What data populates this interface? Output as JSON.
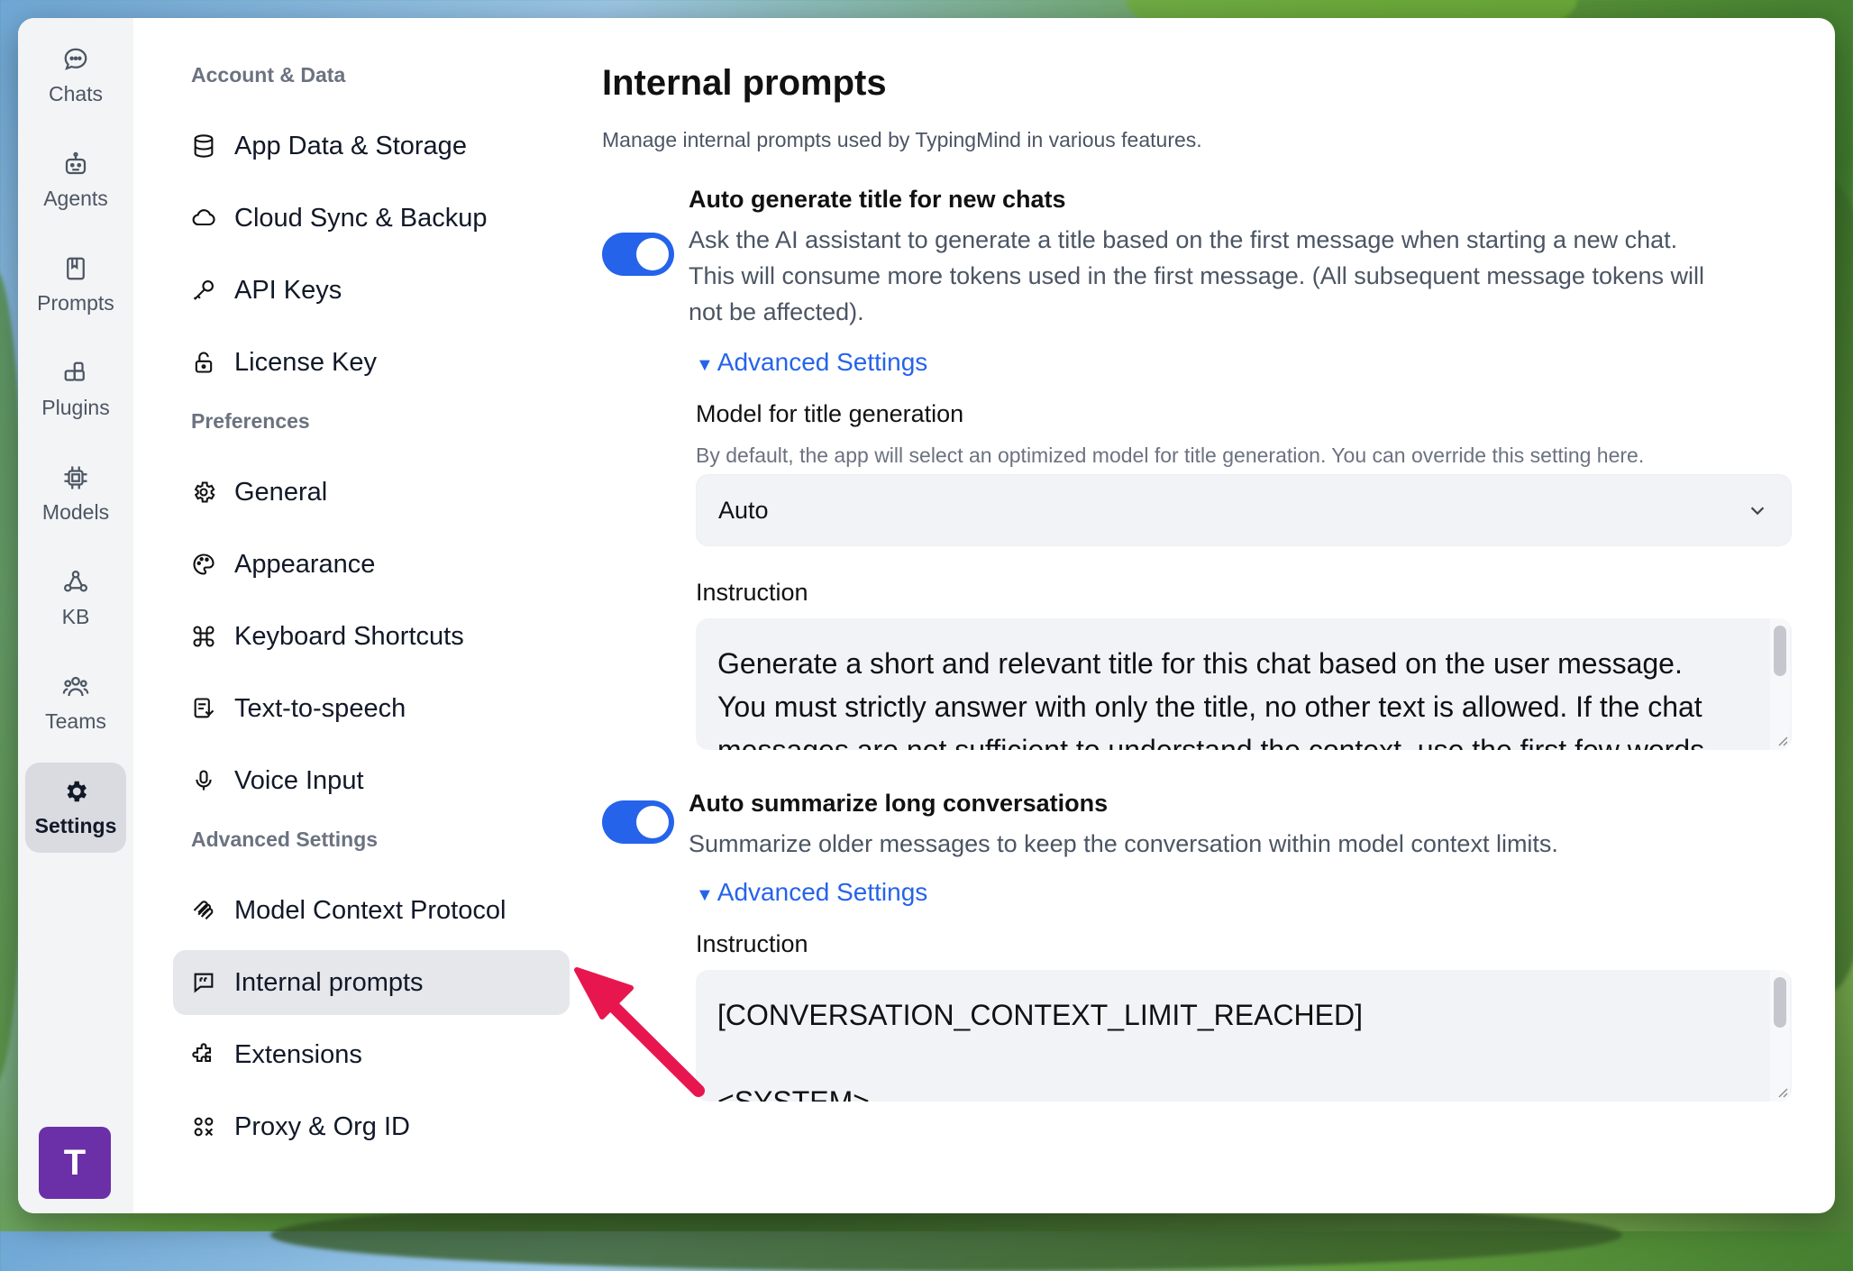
{
  "rail": {
    "items": [
      {
        "label": "Chats",
        "icon": "chat-bubble-icon"
      },
      {
        "label": "Agents",
        "icon": "agents-icon"
      },
      {
        "label": "Prompts",
        "icon": "book-icon"
      },
      {
        "label": "Plugins",
        "icon": "plugin-icon"
      },
      {
        "label": "Models",
        "icon": "chip-icon"
      },
      {
        "label": "KB",
        "icon": "knowledge-base-icon"
      },
      {
        "label": "Teams",
        "icon": "people-icon"
      },
      {
        "label": "Settings",
        "icon": "gear-icon",
        "active": true
      }
    ],
    "avatar_initial": "T",
    "avatar_color": "#6b2fa8"
  },
  "nav": {
    "sections": [
      {
        "title": "Account & Data",
        "items": [
          {
            "label": "App Data & Storage",
            "icon": "database-icon"
          },
          {
            "label": "Cloud Sync & Backup",
            "icon": "cloud-icon"
          },
          {
            "label": "API Keys",
            "icon": "key-icon"
          },
          {
            "label": "License Key",
            "icon": "lock-icon"
          }
        ]
      },
      {
        "title": "Preferences",
        "items": [
          {
            "label": "General",
            "icon": "gear-icon"
          },
          {
            "label": "Appearance",
            "icon": "palette-icon"
          },
          {
            "label": "Keyboard Shortcuts",
            "icon": "command-icon"
          },
          {
            "label": "Text-to-speech",
            "icon": "speech-icon"
          },
          {
            "label": "Voice Input",
            "icon": "microphone-icon"
          }
        ]
      },
      {
        "title": "Advanced Settings",
        "items": [
          {
            "label": "Model Context Protocol",
            "icon": "mcp-icon"
          },
          {
            "label": "Internal prompts",
            "icon": "quote-bubble-icon",
            "active": true
          },
          {
            "label": "Extensions",
            "icon": "puzzle-icon"
          },
          {
            "label": "Proxy & Org ID",
            "icon": "proxy-icon"
          }
        ]
      }
    ]
  },
  "main": {
    "title": "Internal prompts",
    "subtitle": "Manage internal prompts used by TypingMind in various features.",
    "option1": {
      "title": "Auto generate title for new chats",
      "desc_lines": [
        "Ask the AI assistant to generate a title based on the first message when starting a new chat.",
        "This will consume more tokens used in the first message. (All subsequent message tokens will",
        "not be affected)."
      ],
      "enabled": true,
      "advanced_label": "Advanced Settings",
      "model_label": "Model for title generation",
      "model_help": "By default, the app will select an optimized model for title generation. You can override this setting here.",
      "model_value": "Auto",
      "instruction_label": "Instruction",
      "instruction_lines": [
        "Generate a short and relevant title for this chat based on the user message.",
        "You must strictly answer with only the title, no other text is allowed. If the chat",
        "messages are not sufficient to understand the context, use the first few words"
      ]
    },
    "option2": {
      "title": "Auto summarize long conversations",
      "desc": "Summarize older messages to keep the conversation within model context limits.",
      "enabled": true,
      "advanced_label": "Advanced Settings",
      "instruction_label": "Instruction",
      "instruction_lines": [
        "[CONVERSATION_CONTEXT_LIMIT_REACHED]",
        "",
        "<SYSTEM>"
      ]
    },
    "accent_color": "#2563eb"
  },
  "annotation": {
    "arrow_color": "#e8164f"
  }
}
